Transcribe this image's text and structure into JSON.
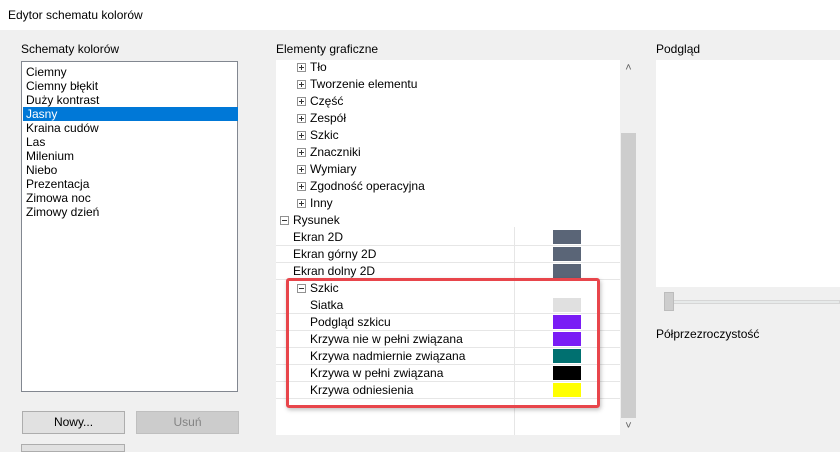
{
  "window": {
    "title": "Edytor schematu kolorów"
  },
  "schemes": {
    "label": "Schematy kolorów",
    "items": [
      {
        "label": "Ciemny"
      },
      {
        "label": "Ciemny błękit"
      },
      {
        "label": "Duży kontrast"
      },
      {
        "label": "Jasny",
        "selected": true
      },
      {
        "label": "Kraina cudów"
      },
      {
        "label": "Las"
      },
      {
        "label": "Milenium"
      },
      {
        "label": "Niebo"
      },
      {
        "label": "Prezentacja"
      },
      {
        "label": "Zimowa noc"
      },
      {
        "label": "Zimowy dzień"
      }
    ],
    "new_button": "Nowy...",
    "delete_button": "Usuń"
  },
  "elements": {
    "label": "Elementy graficzne",
    "groups": [
      {
        "label": "Tło",
        "state": "collapsed"
      },
      {
        "label": "Tworzenie elementu",
        "state": "collapsed"
      },
      {
        "label": "Część",
        "state": "collapsed"
      },
      {
        "label": "Zespół",
        "state": "collapsed"
      },
      {
        "label": "Szkic",
        "state": "collapsed"
      },
      {
        "label": "Znaczniki",
        "state": "collapsed"
      },
      {
        "label": "Wymiary",
        "state": "collapsed"
      },
      {
        "label": "Zgodność operacyjna",
        "state": "collapsed"
      },
      {
        "label": "Inny",
        "state": "collapsed"
      }
    ],
    "drawing": {
      "label": "Rysunek",
      "state": "expanded",
      "items": [
        {
          "label": "Ekran 2D",
          "color": "#5a6577"
        },
        {
          "label": "Ekran górny 2D",
          "color": "#5a6577"
        },
        {
          "label": "Ekran dolny 2D",
          "color": "#5a6577"
        }
      ],
      "sketch": {
        "label": "Szkic",
        "state": "expanded",
        "items": [
          {
            "label": "Siatka",
            "color": "#e0e0e0"
          },
          {
            "label": "Podgląd szkicu",
            "color": "#7a1cf5"
          },
          {
            "label": "Krzywa nie w pełni związana",
            "color": "#7a1cf5"
          },
          {
            "label": "Krzywa nadmiernie związana",
            "color": "#007070"
          },
          {
            "label": "Krzywa w pełni związana",
            "color": "#000000"
          },
          {
            "label": "Krzywa odniesienia",
            "color": "#ffff00"
          }
        ]
      }
    },
    "scroll_up": "˄",
    "scroll_down": "˅"
  },
  "preview": {
    "label": "Podgląd",
    "transparency_label": "Półprzezroczystość"
  },
  "highlight_color": "#e8454b"
}
